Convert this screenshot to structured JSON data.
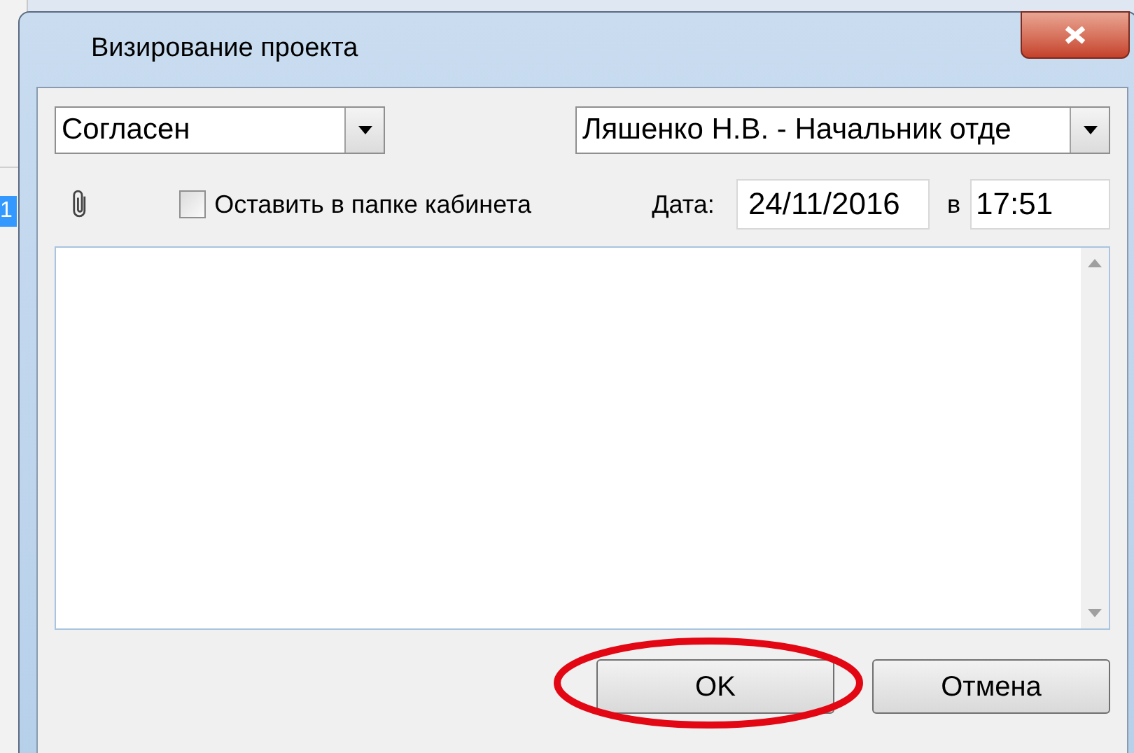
{
  "background_window": {
    "fragments": [
      "1"
    ]
  },
  "dialog": {
    "title": "Визирование проекта",
    "decision": {
      "value": "Согласен"
    },
    "signer": {
      "value": "Ляшенко Н.В. - Начальник отде"
    },
    "keep_in_folder": {
      "label": "Оставить в папке кабинета",
      "checked": false
    },
    "date_label": "Дата:",
    "date": "24/11/2016",
    "time_label": "в",
    "time": "17:51",
    "buttons": [
      {
        "label": "OK",
        "circled": true
      },
      {
        "label": "Отмена",
        "circled": false
      }
    ]
  }
}
